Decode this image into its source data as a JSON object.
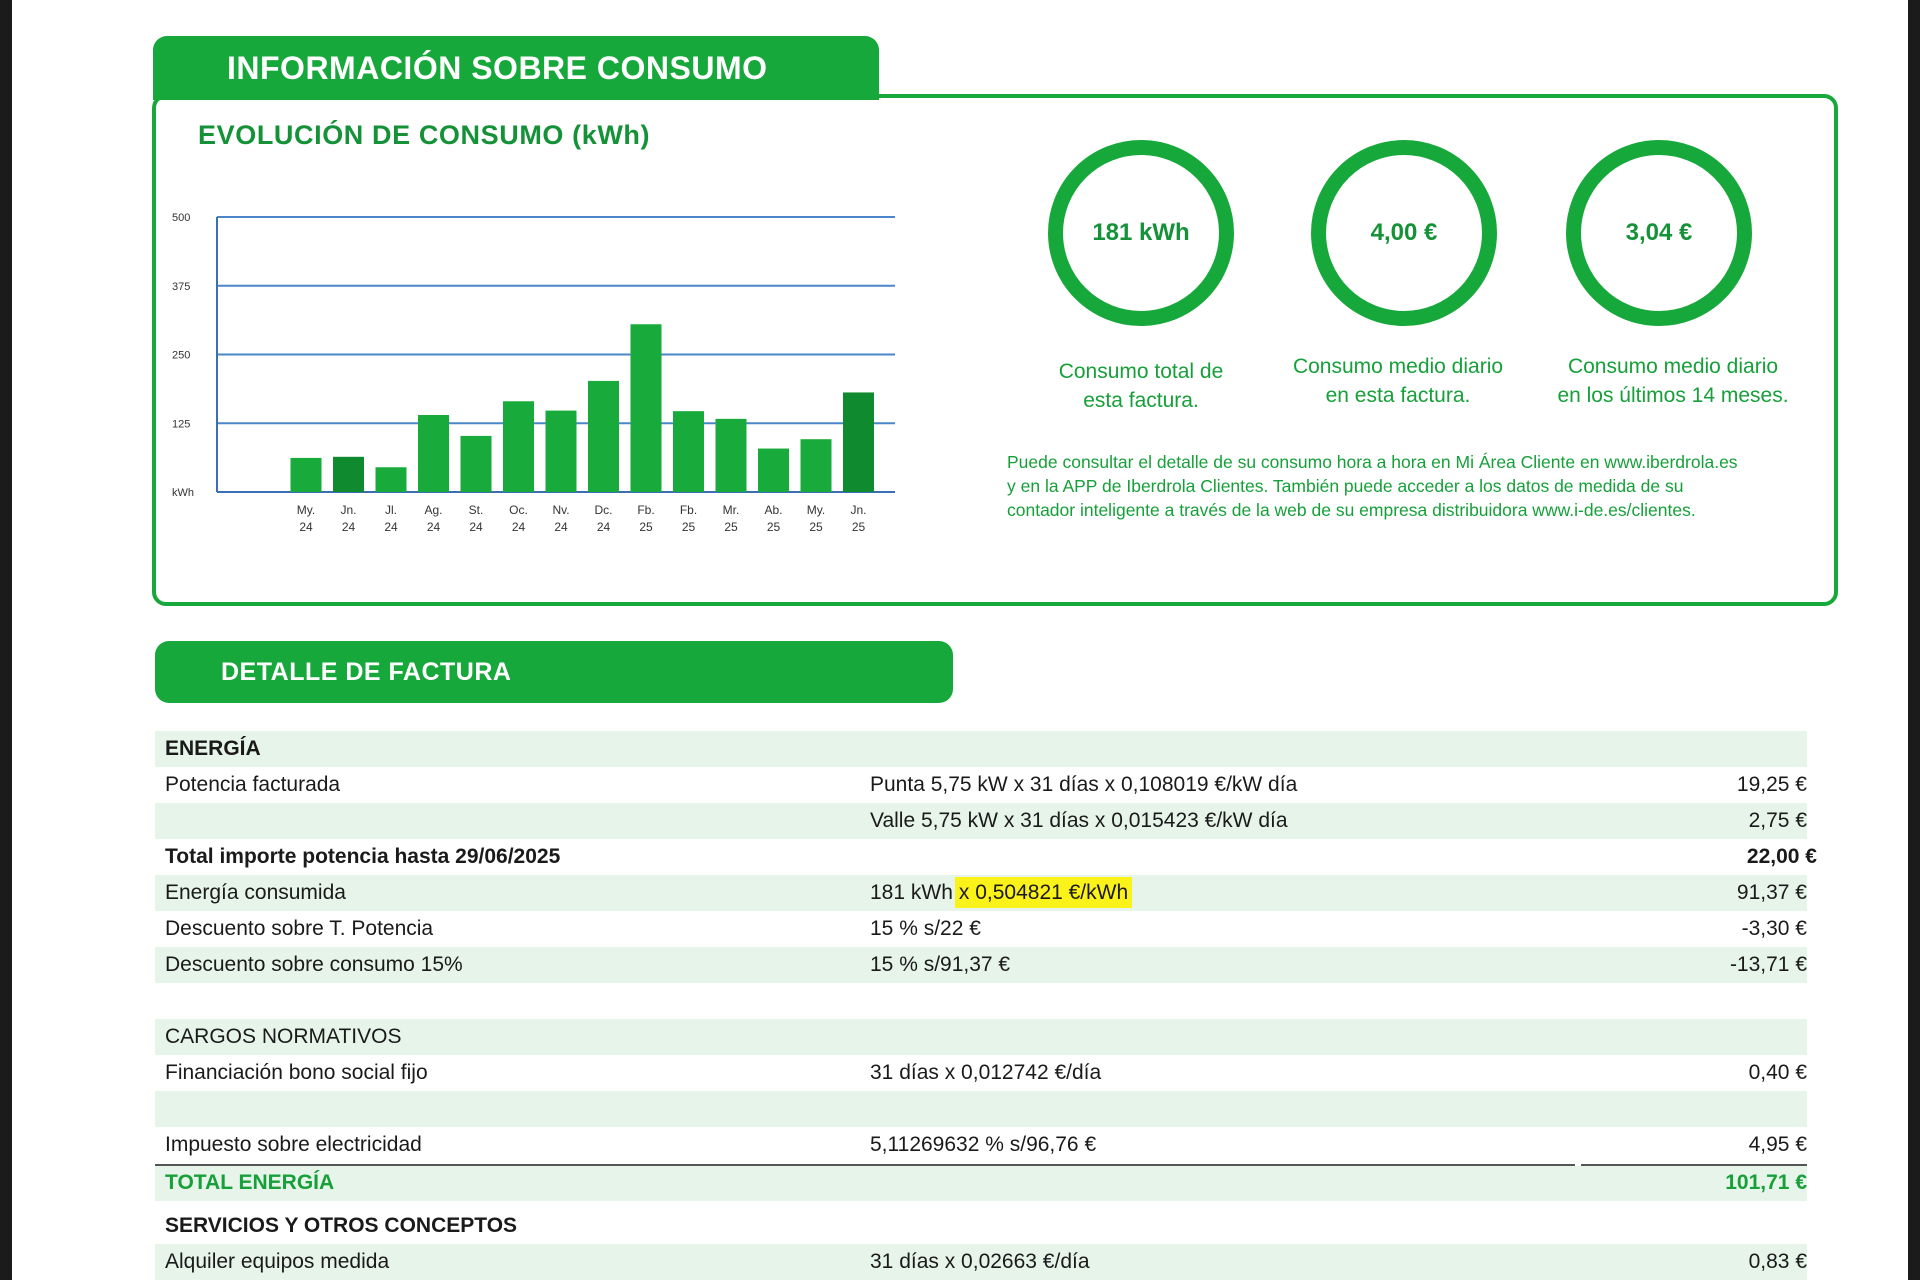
{
  "sections": {
    "consumo_title": "INFORMACIÓN SOBRE CONSUMO",
    "factura_title": "DETALLE DE FACTURA"
  },
  "chart_data": {
    "type": "bar",
    "title": "EVOLUCIÓN DE CONSUMO (kWh)",
    "ylabel": "kWh",
    "ylim": [
      0,
      500
    ],
    "yticks": [
      "500",
      "375",
      "250",
      "125",
      "kWh"
    ],
    "grid": true,
    "categories": [
      [
        "My.",
        "24"
      ],
      [
        "Jn.",
        "24"
      ],
      [
        "Jl.",
        "24"
      ],
      [
        "Ag.",
        "24"
      ],
      [
        "St.",
        "24"
      ],
      [
        "Oc.",
        "24"
      ],
      [
        "Nv.",
        "24"
      ],
      [
        "Dc.",
        "24"
      ],
      [
        "Fb.",
        "25"
      ],
      [
        "Fb.",
        "25"
      ],
      [
        "Mr.",
        "25"
      ],
      [
        "Ab.",
        "25"
      ],
      [
        "My.",
        "25"
      ],
      [
        "Jn.",
        "25"
      ]
    ],
    "values": [
      62,
      64,
      45,
      140,
      102,
      165,
      148,
      202,
      305,
      147,
      133,
      79,
      96,
      181
    ],
    "colors": [
      "#18ab3b",
      "#0f8a2e",
      "#18ab3b",
      "#18ab3b",
      "#18ab3b",
      "#18ab3b",
      "#18ab3b",
      "#18ab3b",
      "#18ab3b",
      "#18ab3b",
      "#18ab3b",
      "#18ab3b",
      "#18ab3b",
      "#0f8a2e"
    ]
  },
  "summary": [
    {
      "value": "181 kWh",
      "caption_1": "Consumo total de",
      "caption_2": "esta factura."
    },
    {
      "value": "4,00 €",
      "caption_1": "Consumo medio diario",
      "caption_2": "en esta factura."
    },
    {
      "value": "3,04 €",
      "caption_1": "Consumo medio diario",
      "caption_2": "en los últimos 14 meses."
    }
  ],
  "info": {
    "line_1": "Puede consultar el detalle de su consumo hora a hora en Mi Área Cliente en www.iberdrola.es",
    "line_2": "y en la APP de Iberdrola Clientes. También puede acceder a los datos de medida de su",
    "line_3": "contador inteligente a través de la web de su empresa distribuidora www.i-de.es/clientes."
  },
  "table": {
    "energia_header": "ENERGÍA",
    "potencia_label": "Potencia facturada",
    "punta_detail": "Punta 5,75 kW x 31 días x 0,108019 €/kW día",
    "punta_amount": "19,25 €",
    "valle_detail": "Valle 5,75 kW x 31 días x 0,015423 €/kW día",
    "valle_amount": "2,75 €",
    "total_potencia_label": "Total importe potencia hasta 29/06/2025",
    "total_potencia_amount": "22,00 €",
    "energia_label": "Energía consumida",
    "energia_detail_a": "181 kWh",
    "energia_detail_b": "x 0,504821 €/kWh",
    "energia_amount": "91,37 €",
    "desc_potencia_label": "Descuento sobre T. Potencia",
    "desc_potencia_detail": "15 % s/22 €",
    "desc_potencia_amount": "-3,30 €",
    "desc_consumo_label": "Descuento sobre consumo 15%",
    "desc_consumo_detail": "15 % s/91,37 €",
    "desc_consumo_amount": "-13,71 €",
    "cargos_header": "CARGOS NORMATIVOS",
    "bono_label": "Financiación bono social fijo",
    "bono_detail": "31 días x 0,012742 €/día",
    "bono_amount": "0,40 €",
    "impuesto_label": "Impuesto sobre electricidad",
    "impuesto_detail": "5,11269632 % s/96,76 €",
    "impuesto_amount": "4,95 €",
    "total_energia_label": "TOTAL ENERGÍA",
    "total_energia_amount": "101,71 €",
    "servicios_header": "SERVICIOS Y OTROS CONCEPTOS",
    "alquiler_label": "Alquiler equipos medida",
    "alquiler_detail": "31 días x 0,02663 €/día",
    "alquiler_amount": "0,83 €"
  }
}
